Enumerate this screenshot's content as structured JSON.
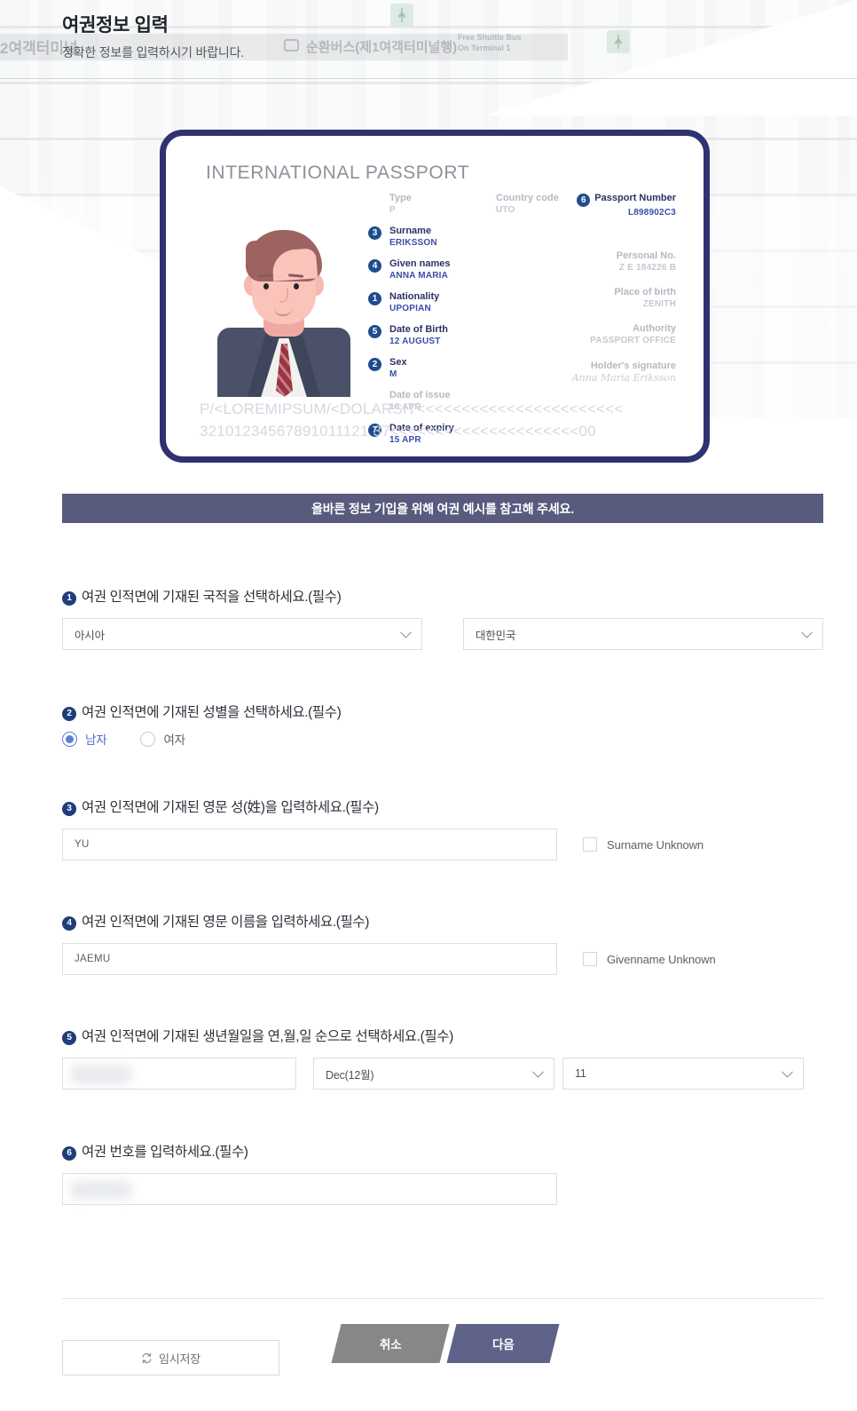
{
  "header": {
    "title": "여권정보 입력",
    "subtitle": "정확한 정보를 입력하시기 바랍니다."
  },
  "backdrop": {
    "sign_text_left": "2여객터미널",
    "sign_text_bus": "순환버스(제1여객터미널행)",
    "sign_text_en": "Free Shuttle Bus\nOn Terminal 1"
  },
  "passport": {
    "heading": "INTERNATIONAL PASSPORT",
    "fields": {
      "type_label": "Type",
      "type_value": "P",
      "country_code_label": "Country code",
      "country_code_value": "UTO",
      "passport_number_label": "Passport Number",
      "passport_number_value": "L898902C3",
      "passport_number_badge": "6",
      "surname_label": "Surname",
      "surname_value": "ERIKSSON",
      "surname_badge": "3",
      "given_names_label": "Given names",
      "given_names_value": "ANNA MARIA",
      "given_names_badge": "4",
      "nationality_label": "Nationality",
      "nationality_value": "UPOPIAN",
      "nationality_badge": "1",
      "dob_label": "Date of Birth",
      "dob_value": "12 AUGUST",
      "dob_badge": "5",
      "sex_label": "Sex",
      "sex_value": "M",
      "sex_badge": "2",
      "issue_label": "Date of issue",
      "issue_value": "16 APR",
      "expiry_label": "Date of expiry",
      "expiry_value": "15 APR",
      "expiry_badge": "7",
      "personal_no_label": "Personal No.",
      "personal_no_value": "Z E 184226 B",
      "place_of_birth_label": "Place of birth",
      "place_of_birth_value": "ZENITH",
      "authority_label": "Authority",
      "authority_value": "PASSPORT OFFICE",
      "signature_label": "Holder's signature",
      "signature_value": "Anna Maria Eriksson"
    },
    "mrz_line1": "P/<LOREMIPSUM/<DOLARSIT<<<<<<<<<<<<<<<<<<<<<<<",
    "mrz_line2": "32101234567891011121 37<<<<<<<<<<<<<<<<<<<<<00"
  },
  "notice": "올바른 정보 기입을 위해 여권 예시를 참고해 주세요.",
  "questions": {
    "q1": {
      "number": "1",
      "title": "여권 인적면에 기재된 국적을 선택하세요.(필수)",
      "region_value": "아시아",
      "country_value": "대한민국"
    },
    "q2": {
      "number": "2",
      "title": "여권 인적면에 기재된 성별을 선택하세요.(필수)",
      "option_male": "남자",
      "option_female": "여자",
      "selected": "남자"
    },
    "q3": {
      "number": "3",
      "title": "여권 인적면에 기재된 영문 성(姓)을 입력하세요.(필수)",
      "surname_value": "YU",
      "unknown_label": "Surname Unknown",
      "unknown_checked": false
    },
    "q4": {
      "number": "4",
      "title": "여권 인적면에 기재된 영문 이름을 입력하세요.(필수)",
      "givenname_value": "JAEMU",
      "unknown_label": "Givenname Unknown",
      "unknown_checked": false
    },
    "q5": {
      "number": "5",
      "title": "여권 인적면에 기재된 생년월일을 연,월,일 순으로 선택하세요.(필수)",
      "year_value": "",
      "month_value": "Dec(12월)",
      "day_value": "11"
    },
    "q6": {
      "number": "6",
      "title": "여권 번호를 입력하세요.(필수)",
      "passport_no_value": ""
    }
  },
  "footer": {
    "cancel_label": "취소",
    "next_label": "다음",
    "save_label": "임시저장"
  },
  "colors": {
    "notice_bg": "#585a7e",
    "next_bg": "#606389",
    "cancel_bg": "#878787",
    "badge_blue": "#1f3d7a",
    "passport_border": "#2e3270",
    "passport_stripe": "#8e1d2c",
    "radio_accent": "#5b7fd4"
  }
}
